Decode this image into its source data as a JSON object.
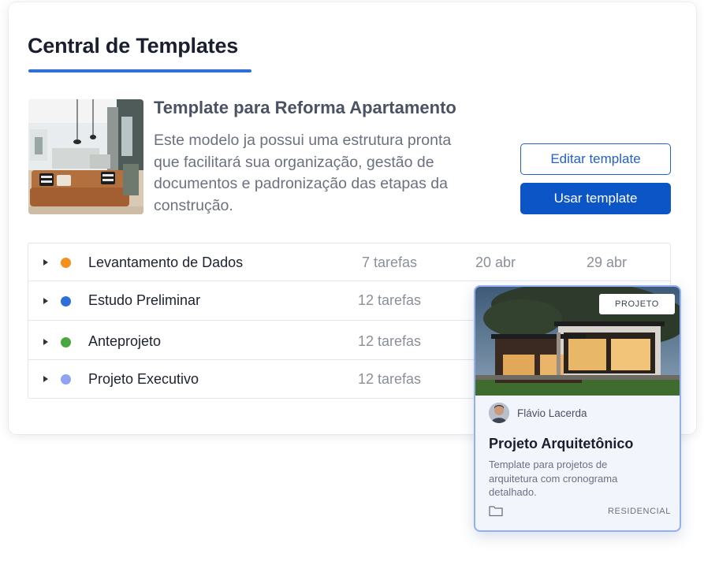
{
  "header": {
    "title": "Central de Templates"
  },
  "template": {
    "name": "Template para Reforma Apartamento",
    "description": "Este modelo ja possui uma estrutura pronta que facilitará sua organização, gestão de documentos e padronização das etapas da construção.",
    "edit_label": "Editar template",
    "use_label": "Usar template"
  },
  "phases": [
    {
      "name": "Levantamento de Dados",
      "tasks": "7 tarefas",
      "start": "20 abr",
      "end": "29 abr",
      "color": "#f5901e"
    },
    {
      "name": "Estudo Preliminar",
      "tasks": "12 tarefas",
      "start": "",
      "end": "",
      "color": "#2f6fd8"
    },
    {
      "name": "Anteprojeto",
      "tasks": "12 tarefas",
      "start": "",
      "end": "",
      "color": "#4aa63f"
    },
    {
      "name": "Projeto Executivo",
      "tasks": "12 tarefas",
      "start": "",
      "end": "",
      "color": "#8fa3f2"
    }
  ],
  "project_card": {
    "badge": "PROJETO",
    "author": "Flávio Lacerda",
    "title": "Projeto Arquitetônico",
    "description": "Template para projetos de arquitetura com cronograma detalhado.",
    "tag": "RESIDENCIAL"
  },
  "colors": {
    "accent": "#0b55c6",
    "underline": "#2f6fd8",
    "card_border": "#93b0f0"
  }
}
